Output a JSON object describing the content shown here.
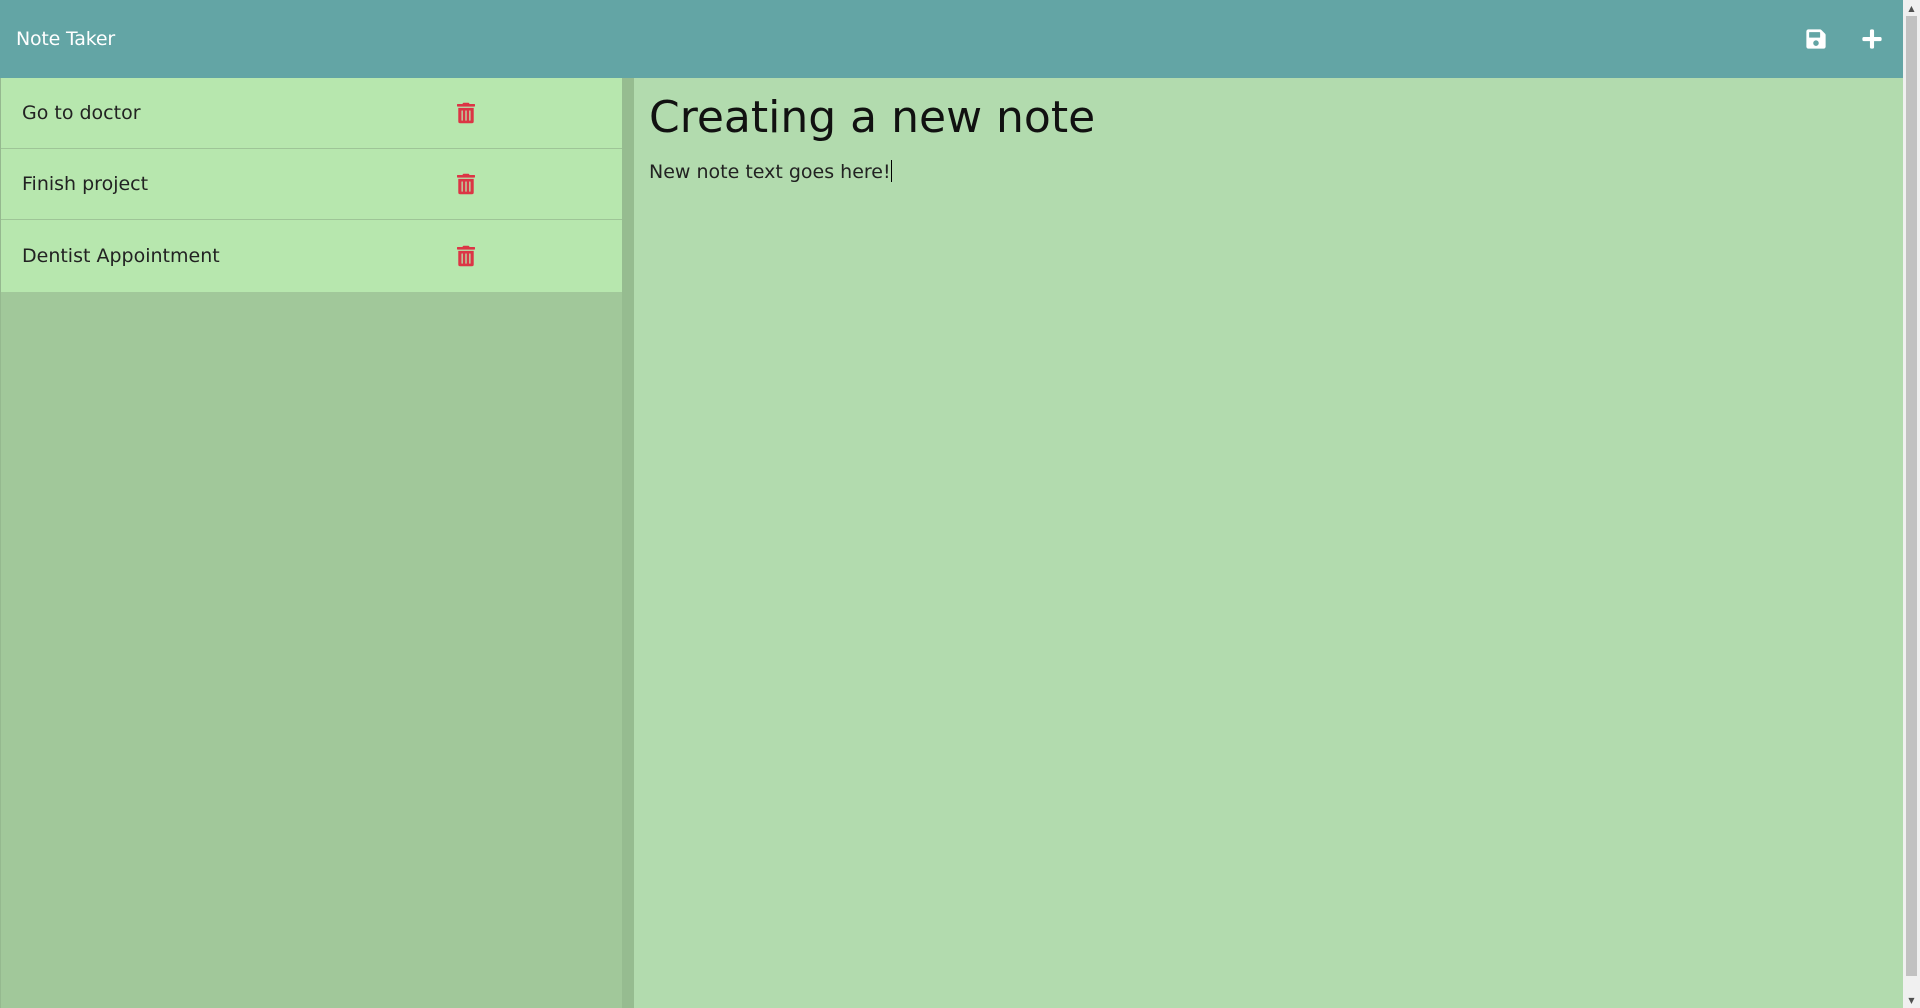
{
  "app": {
    "title": "Note Taker"
  },
  "toolbar": {
    "save_icon": "save-icon",
    "new_icon": "plus-icon"
  },
  "notes": [
    {
      "title": "Go to doctor",
      "delete_icon": "trash-icon"
    },
    {
      "title": "Finish project",
      "delete_icon": "trash-icon"
    },
    {
      "title": "Dentist Appointment",
      "delete_icon": "trash-icon"
    }
  ],
  "editor": {
    "title_value": "Creating a new note",
    "body_value": "New note text goes here!"
  },
  "colors": {
    "navbar": "#63a5a5",
    "note_item": "#b7e7ae",
    "sidebar": "#a1c89a",
    "editor": "#b2dbae",
    "delete_icon": "#dc3545"
  }
}
